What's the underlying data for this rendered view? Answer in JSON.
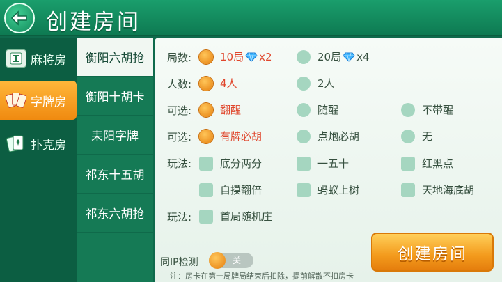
{
  "header": {
    "title": "创建房间"
  },
  "categories": [
    {
      "label": "麻将房",
      "icon": "mahjong-icon",
      "active": false
    },
    {
      "label": "字牌房",
      "icon": "card-fan-icon",
      "active": true
    },
    {
      "label": "扑克房",
      "icon": "poker-icon",
      "active": false
    }
  ],
  "games": [
    {
      "label": "衡阳六胡抢",
      "active": true
    },
    {
      "label": "衡阳十胡卡",
      "active": false
    },
    {
      "label": "耒阳字牌",
      "active": false
    },
    {
      "label": "祁东十五胡",
      "active": false
    },
    {
      "label": "祁东六胡抢",
      "active": false
    }
  ],
  "settings": {
    "rounds": {
      "label": "局数:",
      "opt1": "10局",
      "opt1_cost": "x2",
      "opt2": "20局",
      "opt2_cost": "x4"
    },
    "players": {
      "label": "人数:",
      "opt1": "4人",
      "opt2": "2人"
    },
    "option1": {
      "label": "可选:",
      "opt1": "翻醒",
      "opt2": "随醒",
      "opt3": "不带醒"
    },
    "option2": {
      "label": "可选:",
      "opt1": "有牌必胡",
      "opt2": "点炮必胡",
      "opt3": "无"
    },
    "play1": {
      "label": "玩法:",
      "opt1": "底分两分",
      "opt2": "一五十",
      "opt3": "红黑点",
      "opt4": "自摸翻倍",
      "opt5": "蚂蚁上树",
      "opt6": "天地海底胡"
    },
    "play2": {
      "label": "玩法:",
      "opt1": "首局随机庄"
    }
  },
  "ip_check": {
    "label": "同IP检测",
    "state": "关"
  },
  "note": "注：房卡在第一局牌局结束后扣除，提前解散不扣房卡",
  "create_label": "创建房间",
  "colors": {
    "accent": "#f39a1c",
    "selected_text": "#e0462c",
    "header_green": "#1a9e6c"
  }
}
